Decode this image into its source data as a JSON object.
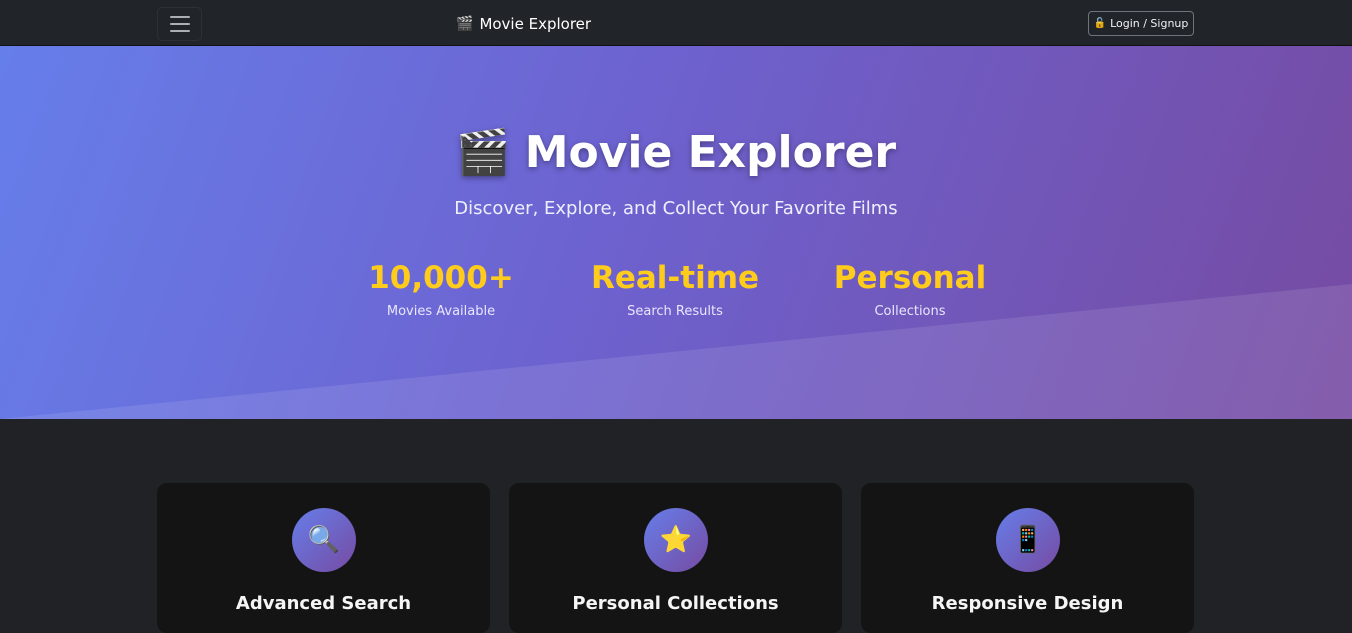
{
  "navbar": {
    "toggler_icon": "hamburger-menu-icon",
    "brand": {
      "icon": "🎬",
      "text": "Movie Explorer"
    },
    "login": {
      "icon": "🔓",
      "label": "Login / Signup"
    }
  },
  "hero": {
    "icon": "🎬",
    "title": "Movie Explorer",
    "subtitle": "Discover, Explore, and Collect Your Favorite Films",
    "stats": [
      {
        "value": "10,000+",
        "label": "Movies Available"
      },
      {
        "value": "Real-time",
        "label": "Search Results"
      },
      {
        "value": "Personal",
        "label": "Collections"
      }
    ],
    "colors": {
      "gradient_start": "#667eea",
      "gradient_end": "#764ba2",
      "stat_accent": "#ffcc1c"
    }
  },
  "features": [
    {
      "icon": "🔍",
      "icon_name": "magnifier-icon",
      "title": "Advanced Search"
    },
    {
      "icon": "⭐",
      "icon_name": "star-icon",
      "title": "Personal Collections"
    },
    {
      "icon": "📱",
      "icon_name": "mobile-phone-icon",
      "title": "Responsive Design"
    }
  ]
}
